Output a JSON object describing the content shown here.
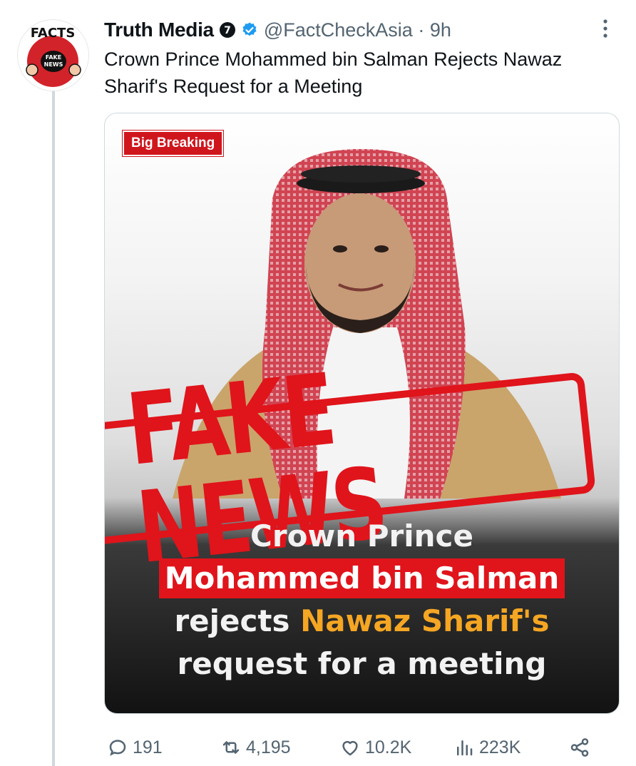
{
  "avatar": {
    "text_top": "FACTS",
    "text_inner": "FAKE NEWS"
  },
  "author": {
    "display_name": "Truth Media",
    "label_badge": "7",
    "handle": "@FactCheckAsia",
    "separator": "·",
    "time": "9h"
  },
  "tweet": {
    "text": "Crown Prince Mohammed bin Salman Rejects Nawaz Sharif's Request for a Meeting"
  },
  "media": {
    "badge": "Big Breaking",
    "stamp": "FAKE NEWS",
    "caption": {
      "line1": "Crown Prince",
      "line2": "Mohammed bin Salman",
      "line3_prefix": "rejects ",
      "line3_highlight": "Nawaz Sharif's",
      "line4": "request for a meeting"
    },
    "colors": {
      "stamp_red": "#e0141b",
      "highlight_orange": "#f5a623"
    }
  },
  "actions": {
    "replies": "191",
    "reposts": "4,195",
    "likes": "10.2K",
    "views": "223K"
  },
  "icons": [
    "more-vertical-icon",
    "verified-badge-icon",
    "reply-icon",
    "repost-icon",
    "like-icon",
    "views-icon",
    "share-icon"
  ]
}
